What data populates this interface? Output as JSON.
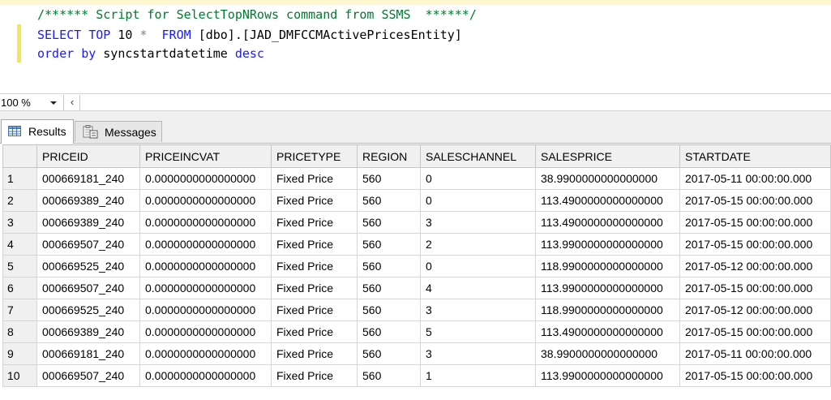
{
  "editor": {
    "comment": "/****** Script for SelectTopNRows command from SSMS  ******/",
    "line2": {
      "kw_select": "SELECT",
      "kw_top": "TOP",
      "num": "10",
      "star": "*",
      "kw_from": "FROM",
      "object": "[dbo].[JAD_DMFCCMActivePricesEntity]"
    },
    "line3": {
      "kw_order": "order",
      "kw_by": "by",
      "column": "syncstartdatetime",
      "kw_desc": "desc"
    }
  },
  "zoombar": {
    "zoom": "100 %",
    "scroll_left": "‹"
  },
  "tabs": {
    "results": {
      "label": "Results",
      "icon": "results-grid-icon"
    },
    "messages": {
      "label": "Messages",
      "icon": "messages-icon"
    }
  },
  "results": {
    "columns": [
      "PRICEID",
      "PRICEINCVAT",
      "PRICETYPE",
      "REGION",
      "SALESCHANNEL",
      "SALESPRICE",
      "STARTDATE"
    ],
    "rows": [
      [
        "1",
        "000669181_240",
        "0.0000000000000000",
        "Fixed Price",
        "560",
        "0",
        "38.9900000000000000",
        "2017-05-11 00:00:00.000"
      ],
      [
        "2",
        "000669389_240",
        "0.0000000000000000",
        "Fixed Price",
        "560",
        "0",
        "113.4900000000000000",
        "2017-05-15 00:00:00.000"
      ],
      [
        "3",
        "000669389_240",
        "0.0000000000000000",
        "Fixed Price",
        "560",
        "3",
        "113.4900000000000000",
        "2017-05-15 00:00:00.000"
      ],
      [
        "4",
        "000669507_240",
        "0.0000000000000000",
        "Fixed Price",
        "560",
        "2",
        "113.9900000000000000",
        "2017-05-15 00:00:00.000"
      ],
      [
        "5",
        "000669525_240",
        "0.0000000000000000",
        "Fixed Price",
        "560",
        "0",
        "118.9900000000000000",
        "2017-05-12 00:00:00.000"
      ],
      [
        "6",
        "000669507_240",
        "0.0000000000000000",
        "Fixed Price",
        "560",
        "4",
        "113.9900000000000000",
        "2017-05-15 00:00:00.000"
      ],
      [
        "7",
        "000669525_240",
        "0.0000000000000000",
        "Fixed Price",
        "560",
        "3",
        "118.9900000000000000",
        "2017-05-12 00:00:00.000"
      ],
      [
        "8",
        "000669389_240",
        "0.0000000000000000",
        "Fixed Price",
        "560",
        "5",
        "113.4900000000000000",
        "2017-05-15 00:00:00.000"
      ],
      [
        "9",
        "000669181_240",
        "0.0000000000000000",
        "Fixed Price",
        "560",
        "3",
        "38.9900000000000000",
        "2017-05-11 00:00:00.000"
      ],
      [
        "10",
        "000669507_240",
        "0.0000000000000000",
        "Fixed Price",
        "560",
        "1",
        "113.9900000000000000",
        "2017-05-15 00:00:00.000"
      ]
    ]
  },
  "colors": {
    "keyword": "#1a1aff",
    "comment": "#007a2e",
    "change_marker": "#f4e65a",
    "grid_header_bg": "#f0f0f0"
  }
}
